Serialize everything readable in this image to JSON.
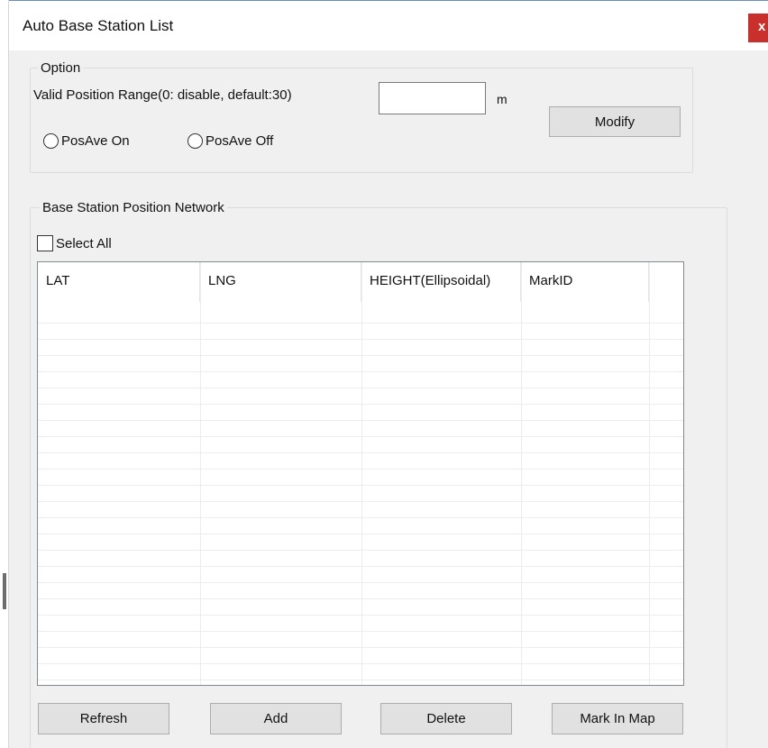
{
  "window": {
    "title": "Auto Base Station List",
    "close_label": "x"
  },
  "option_group": {
    "legend": "Option",
    "range_label": "Valid Position Range(0: disable, default:30)",
    "range_value": "",
    "unit": "m",
    "modify_label": "Modify",
    "posave_on_label": "PosAve On",
    "posave_off_label": "PosAve Off"
  },
  "network_group": {
    "legend": "Base Station Position Network",
    "select_all_label": "Select All",
    "columns": [
      "LAT",
      "LNG",
      "HEIGHT(Ellipsoidal)",
      "MarkID"
    ],
    "rows": []
  },
  "actions": {
    "refresh": "Refresh",
    "add": "Add",
    "delete": "Delete",
    "mark_in_map": "Mark In Map"
  },
  "colors": {
    "close_button": "#c9302c",
    "window_bg": "#f0f0f0",
    "button_bg": "#e1e1e1"
  }
}
